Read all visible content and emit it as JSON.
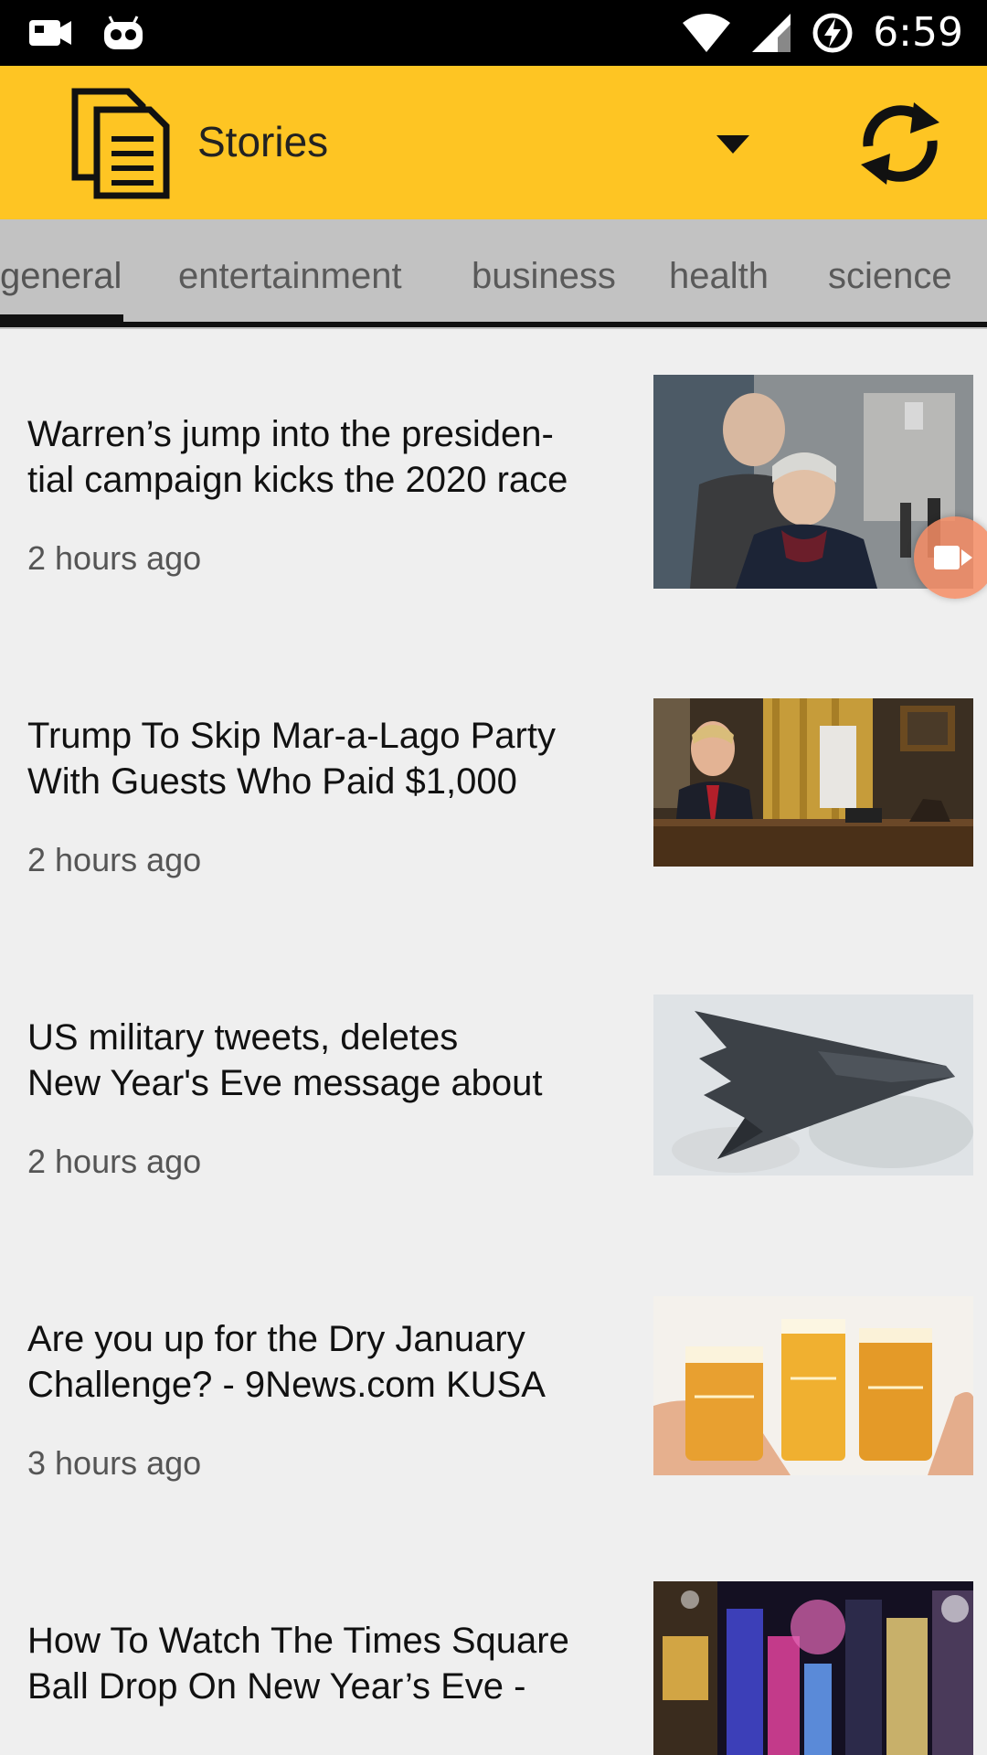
{
  "status_bar": {
    "time": "6:59",
    "icons": [
      "video-camera-icon",
      "android-debug-icon",
      "wifi-icon",
      "cell-signal-icon",
      "battery-charging-icon"
    ]
  },
  "app_bar": {
    "title": "Stories",
    "icons": [
      "document-icon",
      "dropdown-arrow-icon",
      "refresh-icon"
    ],
    "background": "#fec523"
  },
  "tabs": {
    "items": [
      "general",
      "entertainment",
      "business",
      "health",
      "science"
    ],
    "selected": "general"
  },
  "stories": [
    {
      "headline_line1": "Warren’s jump into the presiden-",
      "headline_line2": "tial campaign kicks the 2020 race",
      "time": "2 hours ago",
      "image": "warren-photo"
    },
    {
      "headline_line1": "Trump To Skip Mar-a-Lago Party",
      "headline_line2": "With Guests Who Paid $1,000",
      "time": "2 hours ago",
      "image": "trump-office-photo"
    },
    {
      "headline_line1": "US military tweets, deletes",
      "headline_line2": "New Year's Eve message about",
      "time": "2 hours ago",
      "image": "stealth-bomber-photo"
    },
    {
      "headline_line1": "Are you up for the Dry January",
      "headline_line2": "Challenge? - 9News.com KUSA",
      "time": "3 hours ago",
      "image": "beer-toast-photo"
    },
    {
      "headline_line1": "How To Watch The Times Square",
      "headline_line2": "Ball Drop On New Year’s Eve -",
      "time": "",
      "image": "times-square-photo"
    }
  ],
  "floating_button": "video-record-icon"
}
